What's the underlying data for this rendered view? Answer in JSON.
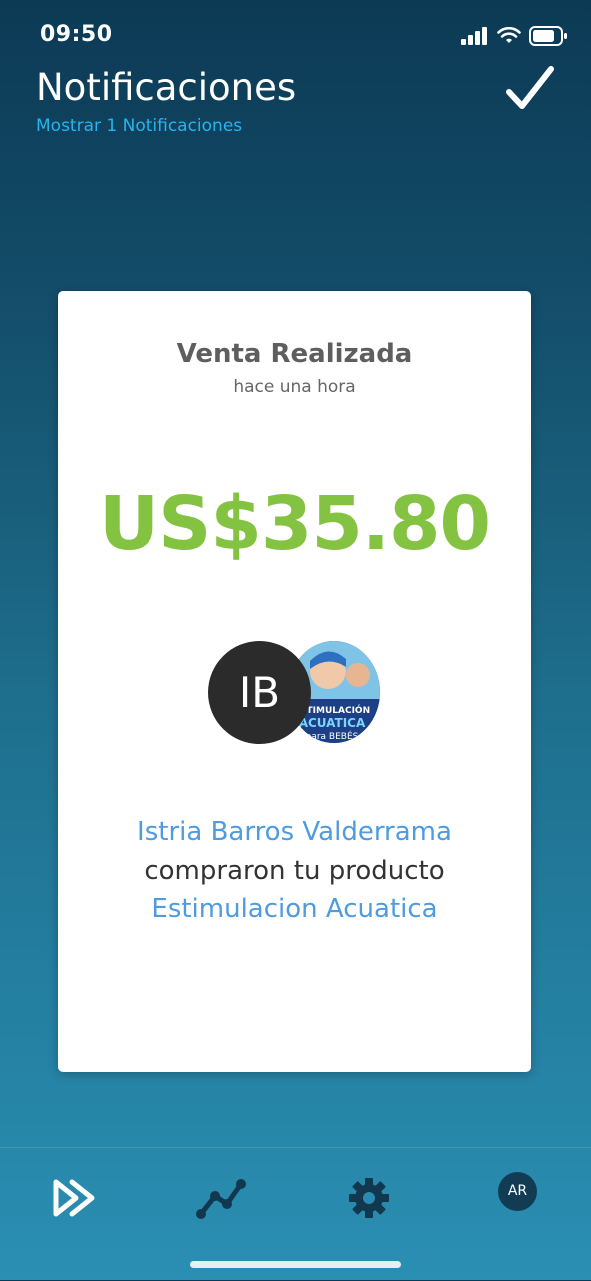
{
  "status_bar": {
    "time": "09:50"
  },
  "header": {
    "title": "Notificaciones",
    "subtitle": "Mostrar 1 Notificaciones"
  },
  "notification": {
    "title": "Venta Realizada",
    "time": "hace una hora",
    "amount": "US$35.80",
    "buyer_initials": "IB",
    "buyer_name": "Istria Barros Valderrama",
    "action_text": "compraron tu producto",
    "product_name": "Estimulacion Acuatica",
    "product_image_text": [
      "ESTIMULACIÓN",
      "ACUATICA",
      "para BEBÉS"
    ]
  },
  "tabbar": {
    "items": [
      {
        "icon": "play-forward-icon"
      },
      {
        "icon": "chart-line-icon"
      },
      {
        "icon": "gear-icon"
      }
    ],
    "profile_initials": "AR"
  },
  "colors": {
    "accent_green": "#84c341",
    "link_blue": "#4e9be0",
    "subtitle_blue": "#27b4ec"
  }
}
